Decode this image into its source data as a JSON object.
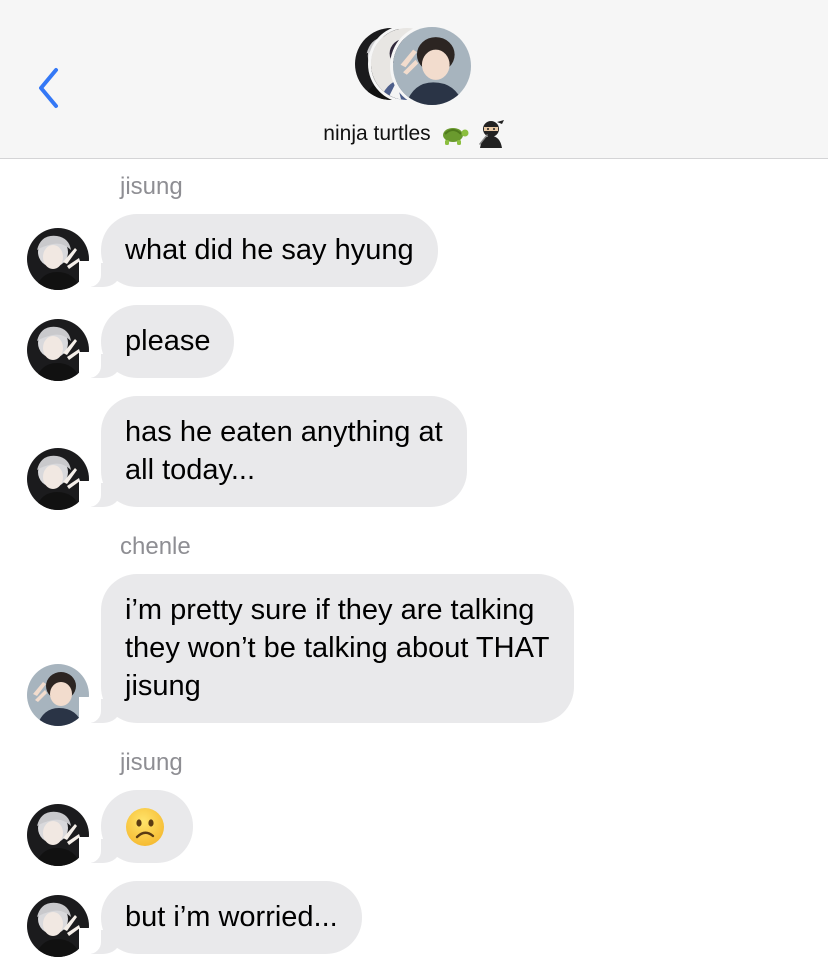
{
  "header": {
    "title": "ninja turtles",
    "title_emojis": [
      "turtle-emoji",
      "ninja-emoji"
    ],
    "back_icon": "chevron-left-icon"
  },
  "colors": {
    "accent": "#3478f6",
    "bubble_incoming": "#e9e9eb",
    "sender_label": "#8e8e93",
    "header_bg": "#f6f6f6"
  },
  "messages": [
    {
      "sender": "jisung",
      "text": "what did he say hyung"
    },
    {
      "sender": "jisung",
      "text": "please"
    },
    {
      "sender": "jisung",
      "lines": [
        "has he eaten anything at",
        "all today..."
      ]
    },
    {
      "sender": "chenle",
      "lines": [
        "i’m pretty sure if they are talking",
        "they won’t be talking about THAT",
        "jisung"
      ]
    },
    {
      "sender": "jisung",
      "emoji": "slightly-frowning-face-emoji"
    },
    {
      "sender": "jisung",
      "text": "but i’m worried..."
    }
  ],
  "sender_labels": [
    "jisung",
    "chenle",
    "jisung"
  ]
}
